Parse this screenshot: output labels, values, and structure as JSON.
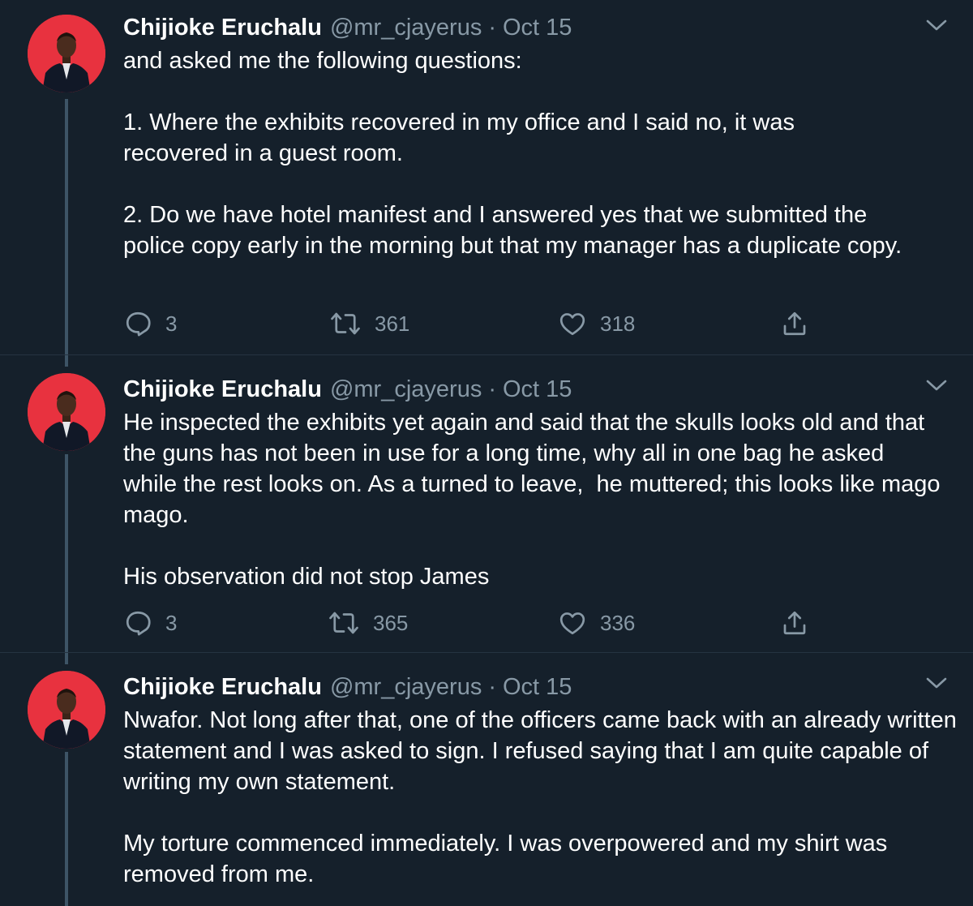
{
  "theme": {
    "background": "#15202b",
    "text": "#ffffff",
    "muted": "#8899a6",
    "avatar_bg": "#e8323f",
    "thread_line": "#3d5466"
  },
  "tweets": [
    {
      "author": {
        "name": "Chijioke Eruchalu",
        "handle": "@mr_cjayerus"
      },
      "separator": "·",
      "date": "Oct 15",
      "paragraphs": [
        "and asked me the following questions:",
        "1. Where the exhibits recovered in my office and I said no, it was recovered in a guest room.",
        "2. Do we have hotel manifest and I answered yes that we submitted the police copy early in the morning but that my manager has a duplicate copy."
      ],
      "replies": "3",
      "retweets": "361",
      "likes": "318",
      "icons": [
        "reply-icon",
        "retweet-icon",
        "like-icon",
        "share-icon",
        "chevron-down-icon"
      ]
    },
    {
      "author": {
        "name": "Chijioke Eruchalu",
        "handle": "@mr_cjayerus"
      },
      "separator": "·",
      "date": "Oct 15",
      "paragraphs": [
        "He inspected the exhibits yet again and said that the skulls looks old and that the guns has not been in use for a long time, why all in one bag he asked  while the rest looks on. As a turned to leave,  he muttered; this looks like mago mago.",
        "His observation did not stop James"
      ],
      "replies": "3",
      "retweets": "365",
      "likes": "336",
      "icons": [
        "reply-icon",
        "retweet-icon",
        "like-icon",
        "share-icon",
        "chevron-down-icon"
      ]
    },
    {
      "author": {
        "name": "Chijioke Eruchalu",
        "handle": "@mr_cjayerus"
      },
      "separator": "·",
      "date": "Oct 15",
      "paragraphs": [
        "Nwafor. Not long after that, one of the officers came back with an already written statement and I was asked to sign. I refused saying that I am quite capable of writing my own statement.",
        "My torture commenced immediately. I was overpowered and my shirt was removed from me."
      ],
      "icons": [
        "chevron-down-icon"
      ]
    }
  ]
}
